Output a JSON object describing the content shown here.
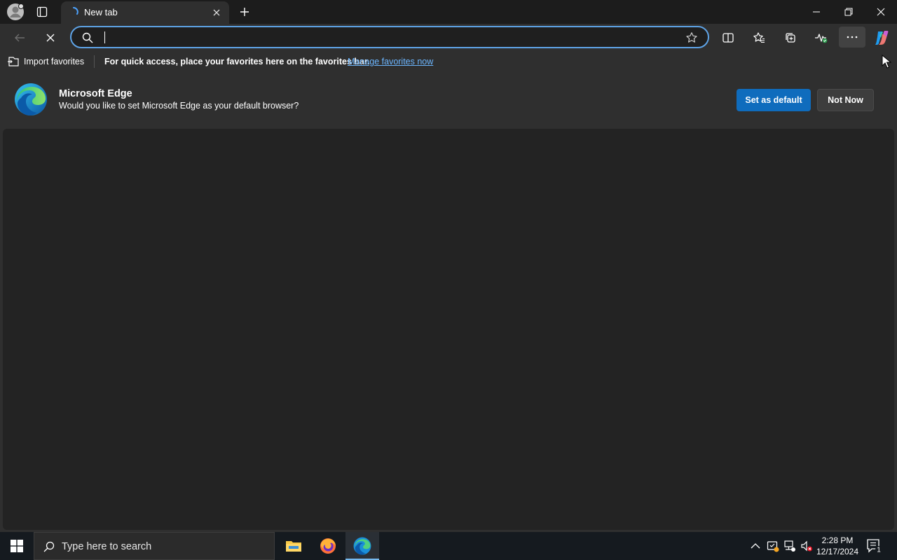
{
  "window": {
    "tab": {
      "title": "New tab",
      "state": "loading"
    }
  },
  "toolbar": {
    "address": {
      "value": "",
      "placeholder": ""
    }
  },
  "favorites_bar": {
    "import_label": "Import favorites",
    "message": "For quick access, place your favorites here on the favorites bar.",
    "link_label": "Manage favorites now"
  },
  "banner": {
    "title": "Microsoft Edge",
    "subtitle": "Would you like to set Microsoft Edge as your default browser?",
    "primary_label": "Set as default",
    "secondary_label": "Not Now"
  },
  "taskbar": {
    "search_placeholder": "Type here to search",
    "apps": [
      "file-explorer",
      "firefox",
      "microsoft-edge"
    ],
    "time": "2:28 PM",
    "date": "12/17/2024",
    "notification_count": "1"
  },
  "colors": {
    "accent": "#0f6cbd",
    "link": "#6cb6ff",
    "address_focus": "#5ea3e6",
    "chrome": "#2f2f2f",
    "titlebar": "#1c1c1c"
  }
}
